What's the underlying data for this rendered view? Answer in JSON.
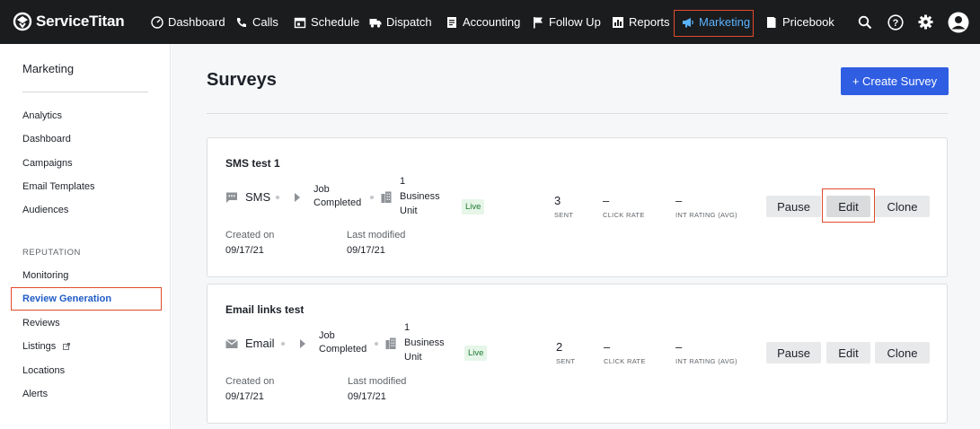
{
  "brand": {
    "name": "ServiceTitan"
  },
  "nav": {
    "items": [
      {
        "label": "Dashboard",
        "icon": "dashboard-icon"
      },
      {
        "label": "Calls",
        "icon": "phone-icon"
      },
      {
        "label": "Schedule",
        "icon": "calendar-icon"
      },
      {
        "label": "Dispatch",
        "icon": "truck-icon"
      },
      {
        "label": "Accounting",
        "icon": "document-icon"
      },
      {
        "label": "Follow Up",
        "icon": "flag-icon"
      },
      {
        "label": "Reports",
        "icon": "bar-chart-icon"
      },
      {
        "label": "Marketing",
        "icon": "megaphone-icon",
        "active": true
      },
      {
        "label": "Pricebook",
        "icon": "book-icon"
      }
    ],
    "accent": "#5ab4ff"
  },
  "sidebar": {
    "title": "Marketing",
    "items": [
      "Analytics",
      "Dashboard",
      "Campaigns",
      "Email Templates",
      "Audiences"
    ],
    "section": "REPUTATION",
    "reputation_items": [
      "Monitoring",
      "Review Generation",
      "Reviews",
      "Listings",
      "Locations",
      "Alerts"
    ],
    "active_item": "Review Generation"
  },
  "page": {
    "title": "Surveys",
    "create_button": "+ Create Survey"
  },
  "surveys": [
    {
      "name": "SMS test 1",
      "channel": "SMS",
      "channel_icon": "chat-bubble-icon",
      "trigger_line1": "Job",
      "trigger_line2": "Completed",
      "bu_line1": "1",
      "bu_line2": "Business",
      "bu_line3": "Unit",
      "status": "Live",
      "sent_value": "3",
      "sent_label": "SENT",
      "click_value": "–",
      "click_label": "CLICK RATE",
      "rating_value": "–",
      "rating_label": "INT RATING (AVG)",
      "created_label": "Created on",
      "created_value": "09/17/21",
      "modified_label": "Last modified",
      "modified_value": "09/17/21",
      "pause": "Pause",
      "edit": "Edit",
      "clone": "Clone"
    },
    {
      "name": "Email links test",
      "channel": "Email",
      "channel_icon": "envelope-icon",
      "trigger_line1": "Job",
      "trigger_line2": "Completed",
      "bu_line1": "1",
      "bu_line2": "Business",
      "bu_line3": "Unit",
      "status": "Live",
      "sent_value": "2",
      "sent_label": "SENT",
      "click_value": "–",
      "click_label": "CLICK RATE",
      "rating_value": "–",
      "rating_label": "INT RATING (AVG)",
      "created_label": "Created on",
      "created_value": "09/17/21",
      "modified_label": "Last modified",
      "modified_value": "09/17/21",
      "pause": "Pause",
      "edit": "Edit",
      "clone": "Clone"
    }
  ],
  "colors": {
    "primary_button": "#2f5ee3",
    "live_badge_bg": "#e6f6e9",
    "live_badge_text": "#1d7a30",
    "highlight_outline": "#e14b2b"
  }
}
